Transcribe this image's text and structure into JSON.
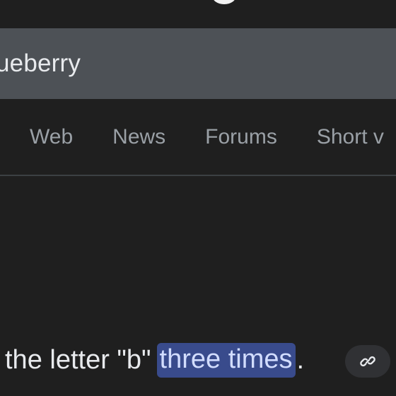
{
  "search": {
    "query_visible": "ueberry"
  },
  "tabs": [
    {
      "label": "Web"
    },
    {
      "label": "News"
    },
    {
      "label": "Forums"
    },
    {
      "label": "Short v"
    }
  ],
  "answer": {
    "prefix": "the letter \"b\"",
    "highlight": "three times",
    "suffix": "."
  },
  "icons": {
    "link": "link-icon",
    "logo_fragment": "logo-fragment"
  },
  "colors": {
    "background": "#1f1f1f",
    "search_bar": "#4d5156",
    "highlight": "#394b8c"
  }
}
